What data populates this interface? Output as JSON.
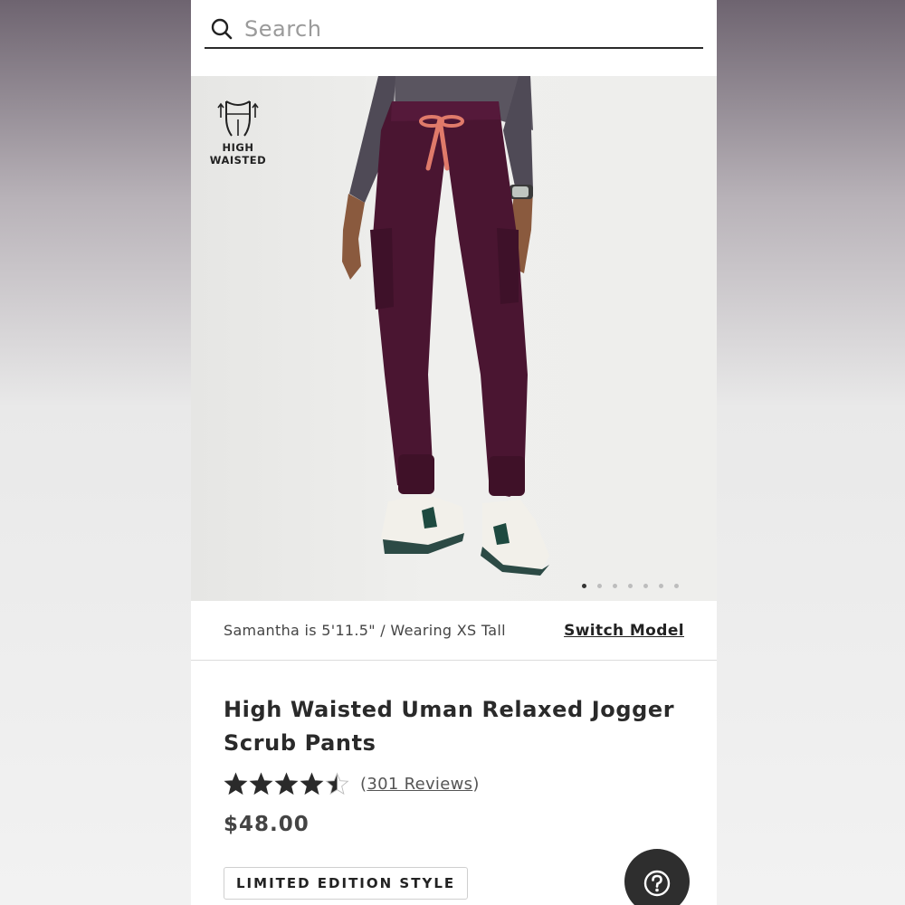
{
  "search": {
    "placeholder": "Search"
  },
  "hero": {
    "badge_line1": "HIGH",
    "badge_line2": "WAISTED",
    "image_count": 7,
    "active_image": 1
  },
  "model": {
    "info": "Samantha is 5'11.5\" / Wearing XS Tall",
    "switch_label": "Switch Model"
  },
  "product": {
    "title": "High Waisted Uman Relaxed Jogger Scrub Pants",
    "rating": 4.5,
    "reviews_open": "(",
    "reviews_link": "301 Reviews",
    "reviews_close": ")",
    "price": "$48.00",
    "tag": "LIMITED EDITION STYLE"
  },
  "colors": {
    "pants": "#4a1531",
    "drawstring": "#e07a6a",
    "text_dark": "#2a2a2a",
    "help_button": "#2e2e2e"
  },
  "icons": {
    "search": "search-icon",
    "waist": "high-waist-icon",
    "help": "help-icon"
  }
}
